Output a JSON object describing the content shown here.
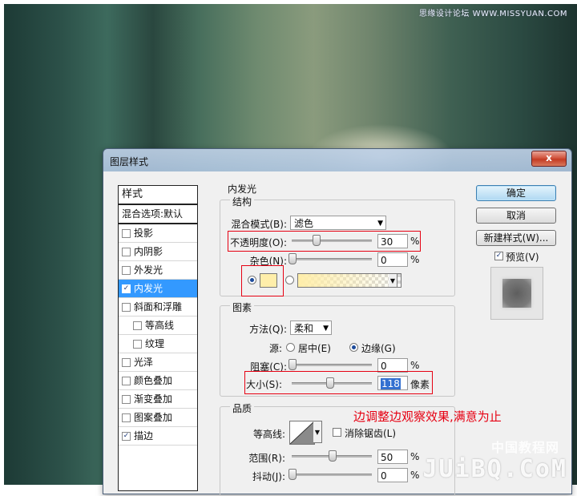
{
  "watermark_top": "思缘设计论坛 WWW.MISSYUAN.COM",
  "watermark_cn": "中国教程网",
  "watermark_url": "JUiBQ.CoM",
  "dialog": {
    "title": "图层样式",
    "close_label": "x",
    "styles_header": "样式",
    "blend_options": "混合选项:默认",
    "style_items": [
      {
        "label": "投影",
        "checked": false,
        "indent": false
      },
      {
        "label": "内阴影",
        "checked": false,
        "indent": false
      },
      {
        "label": "外发光",
        "checked": false,
        "indent": false
      },
      {
        "label": "内发光",
        "checked": true,
        "indent": false,
        "selected": true
      },
      {
        "label": "斜面和浮雕",
        "checked": false,
        "indent": false
      },
      {
        "label": "等高线",
        "checked": false,
        "indent": true
      },
      {
        "label": "纹理",
        "checked": false,
        "indent": true
      },
      {
        "label": "光泽",
        "checked": false,
        "indent": false
      },
      {
        "label": "颜色叠加",
        "checked": false,
        "indent": false
      },
      {
        "label": "渐变叠加",
        "checked": false,
        "indent": false
      },
      {
        "label": "图案叠加",
        "checked": false,
        "indent": false
      },
      {
        "label": "描边",
        "checked": true,
        "indent": false
      }
    ],
    "panel_title": "内发光",
    "structure": {
      "legend": "结构",
      "blend_mode_label": "混合模式(B):",
      "blend_mode_value": "滤色",
      "opacity_label": "不透明度(O):",
      "opacity_value": "30",
      "opacity_fraction": 0.3,
      "noise_label": "杂色(N):",
      "noise_value": "0",
      "noise_fraction": 0,
      "percent": "%",
      "glow_color": "#ffeeaa"
    },
    "elements": {
      "legend": "图素",
      "method_label": "方法(Q):",
      "method_value": "柔和",
      "source_label": "源:",
      "source_center": "居中(E)",
      "source_edge": "边缘(G)",
      "choke_label": "阻塞(C):",
      "choke_value": "0",
      "choke_fraction": 0,
      "size_label": "大小(S):",
      "size_value": "118",
      "size_fraction": 0.47,
      "size_unit": "像素",
      "percent": "%"
    },
    "quality": {
      "legend": "品质",
      "contour_label": "等高线:",
      "anti_alias_label": "消除锯齿(L)",
      "range_label": "范围(R):",
      "range_value": "50",
      "range_fraction": 0.5,
      "jitter_label": "抖动(J):",
      "jitter_value": "0",
      "jitter_fraction": 0,
      "percent": "%"
    },
    "buttons": {
      "ok": "确定",
      "cancel": "取消",
      "new_style": "新建样式(W)...",
      "preview": "预览(V)"
    },
    "annotation": "边调整边观察效果,满意为止",
    "accent_color": "#3399ff",
    "annotation_color": "#e60012"
  }
}
